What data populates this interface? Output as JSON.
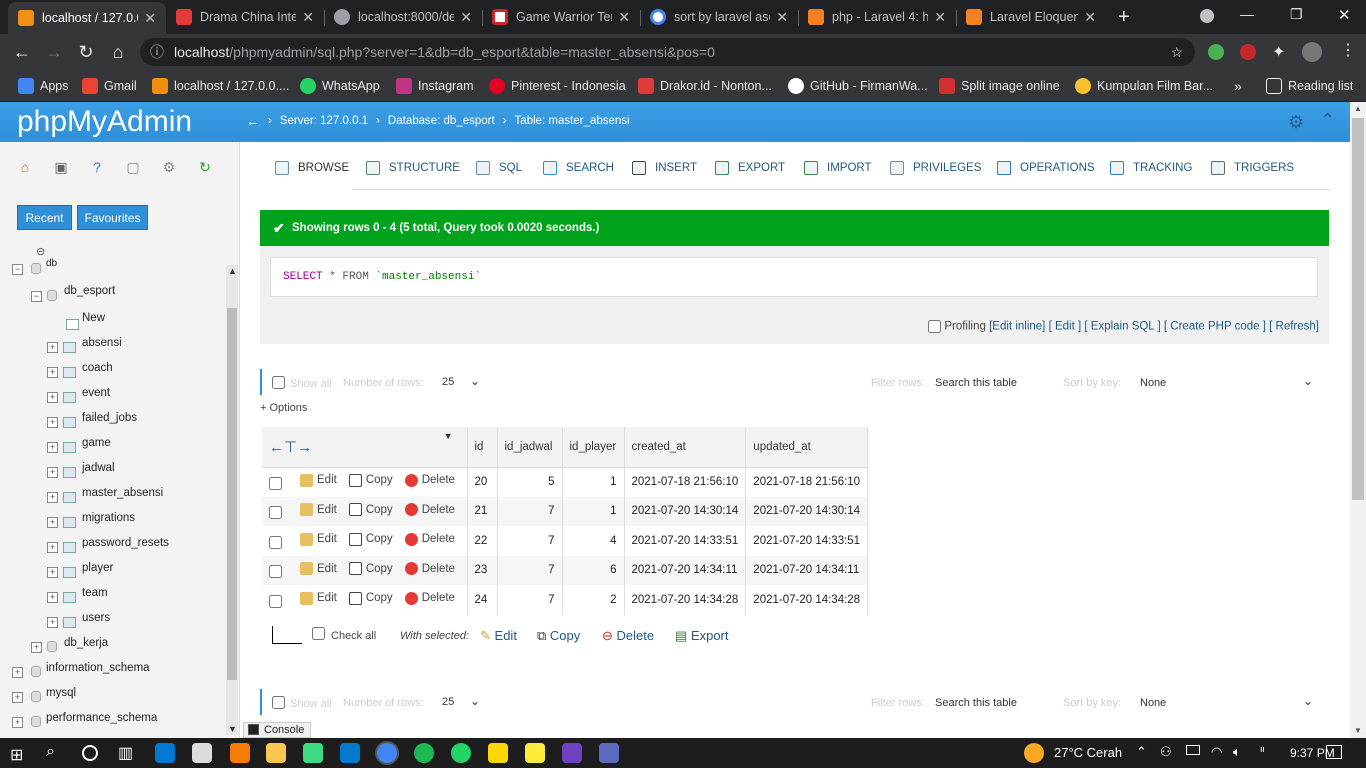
{
  "browser": {
    "tabs": [
      {
        "title": "localhost / 127.0.0",
        "active": true
      },
      {
        "title": "Drama China Inte"
      },
      {
        "title": "localhost:8000/de"
      },
      {
        "title": "Game Warrior Ter"
      },
      {
        "title": "sort by laravel asc"
      },
      {
        "title": "php - Laravel 4: h"
      },
      {
        "title": "Laravel Eloquent"
      }
    ],
    "url_host": "localhost",
    "url_path": "/phpmyadmin/sql.php?server=1&db=db_esport&table=master_absensi&pos=0",
    "bookmarks": [
      "Apps",
      "Gmail",
      "localhost / 127.0.0....",
      "WhatsApp",
      "Instagram",
      "Pinterest - Indonesia",
      "Drakor.id - Nonton...",
      "GitHub - FirmanWa...",
      "Split image online",
      "Kumpulan Film Bar..."
    ],
    "reading_list": "Reading list"
  },
  "pma": {
    "logo": "phpMyAdmin",
    "breadcrumb": {
      "server": "Server: 127.0.0.1",
      "database": "Database: db_esport",
      "table": "Table: master_absensi"
    },
    "buttons": {
      "recent": "Recent",
      "favourites": "Favourites"
    },
    "tree": {
      "root": "db",
      "db_esport": "db_esport",
      "new": "New",
      "tables": [
        "absensi",
        "coach",
        "event",
        "failed_jobs",
        "game",
        "jadwal",
        "master_absensi",
        "migrations",
        "password_resets",
        "player",
        "team",
        "users"
      ],
      "other_dbs": [
        "db_kerja",
        "information_schema",
        "mysql",
        "performance_schema"
      ]
    },
    "menu_tabs": [
      "Browse",
      "Structure",
      "SQL",
      "Search",
      "Insert",
      "Export",
      "Import",
      "Privileges",
      "Operations",
      "Tracking",
      "Triggers"
    ],
    "success_message": "Showing rows 0 - 4 (5 total, Query took 0.0020 seconds.)",
    "sql_keyword": "SELECT",
    "sql_rest": " * FROM ",
    "sql_table": "`master_absensi`",
    "profiling": {
      "label": "Profiling",
      "edit_inline": "[Edit inline]",
      "edit": "[ Edit ]",
      "explain": "[ Explain SQL ]",
      "php": "[ Create PHP code ]",
      "refresh": "[ Refresh]"
    },
    "nav": {
      "show_all": "Show all",
      "num_rows_label": "Number of rows:",
      "num_rows": "25",
      "filter_label": "Filter rows:",
      "filter_placeholder": "Search this table",
      "sort_label": "Sort by key:",
      "sort_value": "None"
    },
    "options": "+ Options",
    "columns": [
      "id",
      "id_jadwal",
      "id_player",
      "created_at",
      "updated_at"
    ],
    "row_actions": {
      "edit": "Edit",
      "copy": "Copy",
      "delete": "Delete"
    },
    "rows": [
      {
        "id": "20",
        "id_jadwal": "5",
        "id_player": "1",
        "created_at": "2021-07-18 21:56:10",
        "updated_at": "2021-07-18 21:56:10"
      },
      {
        "id": "21",
        "id_jadwal": "7",
        "id_player": "1",
        "created_at": "2021-07-20 14:30:14",
        "updated_at": "2021-07-20 14:30:14"
      },
      {
        "id": "22",
        "id_jadwal": "7",
        "id_player": "4",
        "created_at": "2021-07-20 14:33:51",
        "updated_at": "2021-07-20 14:33:51"
      },
      {
        "id": "23",
        "id_jadwal": "7",
        "id_player": "6",
        "created_at": "2021-07-20 14:34:11",
        "updated_at": "2021-07-20 14:34:11"
      },
      {
        "id": "24",
        "id_jadwal": "7",
        "id_player": "2",
        "created_at": "2021-07-20 14:34:28",
        "updated_at": "2021-07-20 14:34:28"
      }
    ],
    "bulk": {
      "check_all": "Check all",
      "with_selected": "With selected:",
      "edit": "Edit",
      "copy": "Copy",
      "delete": "Delete",
      "export": "Export"
    },
    "console": "Console"
  },
  "taskbar": {
    "weather": "27°C  Cerah",
    "time": "9:37 PM"
  },
  "colors": {
    "pma_blue": "#2f8fd8",
    "success_green": "#01a31c",
    "link": "#235a81"
  }
}
